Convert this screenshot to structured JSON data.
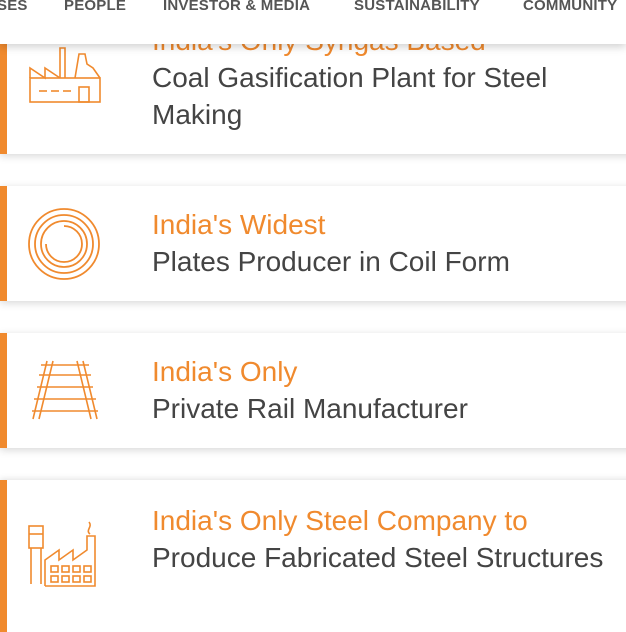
{
  "nav": {
    "items": [
      "SES",
      "PEOPLE",
      "INVESTOR & MEDIA",
      "SUSTAINABILITY",
      "COMMUNITY"
    ]
  },
  "cards": [
    {
      "highlight": "India's Only Syngas Based",
      "description": "Coal Gasification Plant for Steel Making",
      "icon": "gasification-plant-icon"
    },
    {
      "highlight": "India's Widest",
      "description": "Plates Producer in Coil Form",
      "icon": "steel-coil-icon"
    },
    {
      "highlight": "India's Only",
      "description": "Private Rail Manufacturer",
      "icon": "rail-track-icon"
    },
    {
      "highlight": "India's Only Steel Company to",
      "description": "Produce Fabricated Steel Structures",
      "icon": "factory-icon"
    }
  ],
  "colors": {
    "accent": "#f08a2e",
    "text": "#444444"
  }
}
